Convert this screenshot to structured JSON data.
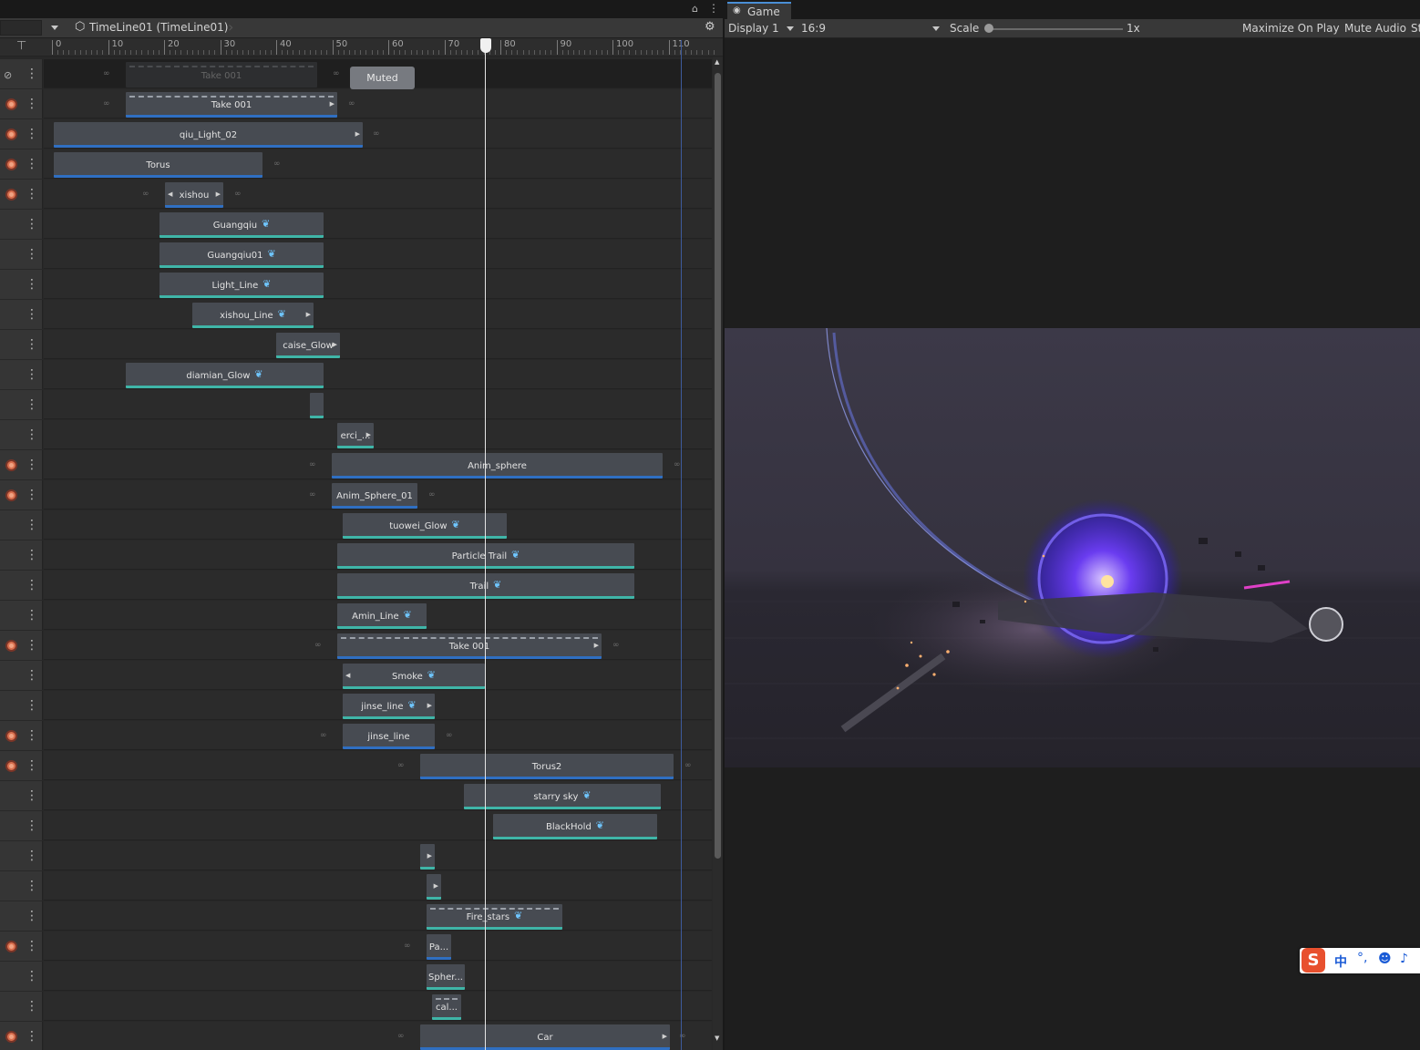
{
  "timeline": {
    "title": "TimeLine01 (TimeLine01)",
    "ruler_ticks": [
      "0",
      "10",
      "20",
      "30",
      "40",
      "50",
      "60",
      "70",
      "80",
      "90",
      "100",
      "110"
    ],
    "tracks": [
      {
        "kind": "muted",
        "clips": [
          {
            "label": "Take 001",
            "type": "anim"
          }
        ],
        "muted_label": "Muted"
      },
      {
        "kind": "rec",
        "clips": [
          {
            "label": "Take 001",
            "type": "anim"
          }
        ]
      },
      {
        "kind": "rec",
        "clips": [
          {
            "label": "qiu_Light_02",
            "type": "anim"
          }
        ]
      },
      {
        "kind": "rec",
        "clips": [
          {
            "label": "Torus",
            "type": "anim"
          }
        ]
      },
      {
        "kind": "rec",
        "clips": [
          {
            "label": "xishou",
            "type": "anim"
          }
        ]
      },
      {
        "kind": "plain",
        "clips": [
          {
            "label": "Guangqiu",
            "type": "ctrl"
          }
        ]
      },
      {
        "kind": "plain",
        "clips": [
          {
            "label": "Guangqiu01",
            "type": "ctrl"
          }
        ]
      },
      {
        "kind": "plain",
        "clips": [
          {
            "label": "Light_Line",
            "type": "ctrl"
          }
        ]
      },
      {
        "kind": "plain",
        "clips": [
          {
            "label": "xishou_Line",
            "type": "ctrl"
          }
        ]
      },
      {
        "kind": "plain",
        "clips": [
          {
            "label": "caise_Glow",
            "type": "ctrl"
          }
        ]
      },
      {
        "kind": "plain",
        "clips": [
          {
            "label": "diamian_Glow",
            "type": "ctrl"
          }
        ]
      },
      {
        "kind": "plain",
        "clips": [
          {
            "label": "",
            "type": "ctrl"
          }
        ]
      },
      {
        "kind": "plain",
        "clips": [
          {
            "label": "erci_...",
            "type": "ctrl"
          }
        ]
      },
      {
        "kind": "rec",
        "clips": [
          {
            "label": "Anim_sphere",
            "type": "anim"
          }
        ]
      },
      {
        "kind": "rec",
        "clips": [
          {
            "label": "Anim_Sphere_01",
            "type": "anim"
          }
        ]
      },
      {
        "kind": "plain",
        "clips": [
          {
            "label": "tuowei_Glow",
            "type": "ctrl"
          }
        ]
      },
      {
        "kind": "plain",
        "clips": [
          {
            "label": "Particle Trail",
            "type": "ctrl"
          }
        ]
      },
      {
        "kind": "plain",
        "clips": [
          {
            "label": "Trail",
            "type": "ctrl"
          }
        ]
      },
      {
        "kind": "plain",
        "clips": [
          {
            "label": "Amin_Line",
            "type": "ctrl"
          }
        ]
      },
      {
        "kind": "rec",
        "clips": [
          {
            "label": "Take 001",
            "type": "anim"
          }
        ]
      },
      {
        "kind": "plain",
        "clips": [
          {
            "label": "Smoke",
            "type": "ctrl"
          }
        ]
      },
      {
        "kind": "plain",
        "clips": [
          {
            "label": "jinse_line",
            "type": "ctrl"
          }
        ]
      },
      {
        "kind": "rec",
        "clips": [
          {
            "label": "jinse_line",
            "type": "anim"
          }
        ]
      },
      {
        "kind": "rec",
        "clips": [
          {
            "label": "Torus2",
            "type": "anim"
          }
        ]
      },
      {
        "kind": "plain",
        "clips": [
          {
            "label": "starry sky",
            "type": "ctrl"
          }
        ]
      },
      {
        "kind": "plain",
        "clips": [
          {
            "label": "BlackHold",
            "type": "ctrl"
          }
        ]
      },
      {
        "kind": "plain",
        "clips": [
          {
            "label": "",
            "type": "ctrl"
          }
        ]
      },
      {
        "kind": "plain",
        "clips": [
          {
            "label": "",
            "type": "ctrl"
          }
        ]
      },
      {
        "kind": "plain",
        "clips": [
          {
            "label": "Fire_stars",
            "type": "ctrl"
          }
        ]
      },
      {
        "kind": "rec",
        "clips": [
          {
            "label": "Pa...",
            "type": "anim"
          }
        ]
      },
      {
        "kind": "plain",
        "clips": [
          {
            "label": "Spher...",
            "type": "ctrl"
          }
        ]
      },
      {
        "kind": "plain",
        "clips": [
          {
            "label": "cal...",
            "type": "ctrl"
          }
        ]
      },
      {
        "kind": "rec",
        "clips": [
          {
            "label": "Car",
            "type": "anim"
          }
        ]
      }
    ]
  },
  "game": {
    "tab_label": "Game",
    "display": "Display 1",
    "aspect": "16:9",
    "scale_label": "Scale",
    "scale_value": "1x",
    "scale_level": 0,
    "maximize": "Maximize On Play",
    "mute": "Mute Audio",
    "stats_cut": "St"
  },
  "ime": {
    "lang": "中"
  },
  "colors": {
    "anim_underline": "#2f6fc2",
    "control_underline": "#3fb5a8",
    "record": "#d96f4e",
    "playhead": "#e4e4e4"
  }
}
